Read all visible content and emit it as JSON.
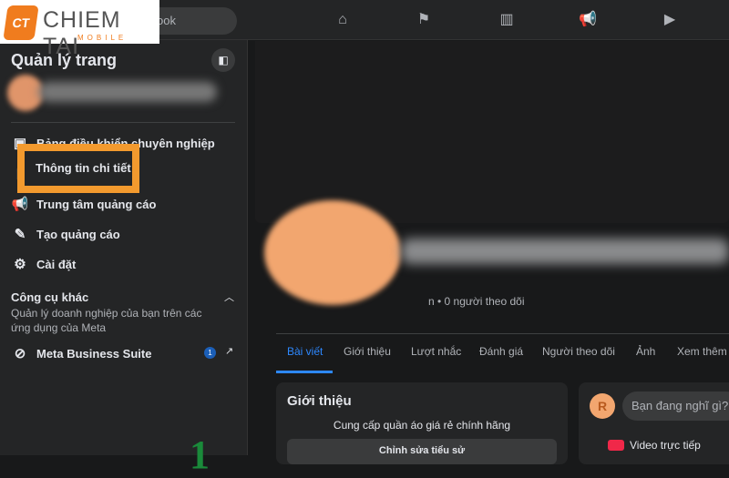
{
  "logo": {
    "badge": "CT",
    "name": "CHIEM TAI",
    "sub": "MOBILE"
  },
  "search": {
    "placeholder": "ook"
  },
  "nav": [
    "home-icon",
    "flag-icon",
    "chart-icon",
    "megaphone-icon",
    "video-icon"
  ],
  "sidebar": {
    "title": "Quản lý trang",
    "items": [
      {
        "label": "Bảng điều khiển chuyên nghiệp"
      },
      {
        "label": "Thông tin chi tiết"
      },
      {
        "label": "Trung tâm quảng cáo"
      },
      {
        "label": "Tạo quảng cáo"
      },
      {
        "label": "Cài đặt"
      }
    ],
    "tools_heading": "Công cụ khác",
    "tools_desc": "Quản lý doanh nghiệp của bạn trên các ứng dụng của Meta",
    "meta": "Meta Business Suite",
    "meta_badge": "1"
  },
  "annotation": {
    "step": "1",
    "highlight_color": "#f39a2e"
  },
  "profile": {
    "followers": "n • 0 người theo dõi"
  },
  "tabs": [
    "Bài viết",
    "Giới thiệu",
    "Lượt nhắc",
    "Đánh giá",
    "Người theo dõi",
    "Ảnh",
    "Xem thêm"
  ],
  "intro": {
    "heading": "Giới thiệu",
    "desc": "Cung cấp quần áo giá rẻ chính hãng",
    "edit": "Chỉnh sửa tiểu sử"
  },
  "composer": {
    "avatar": "R",
    "placeholder": "Bạn đang nghĩ gì?",
    "live": "Video trực tiếp"
  }
}
